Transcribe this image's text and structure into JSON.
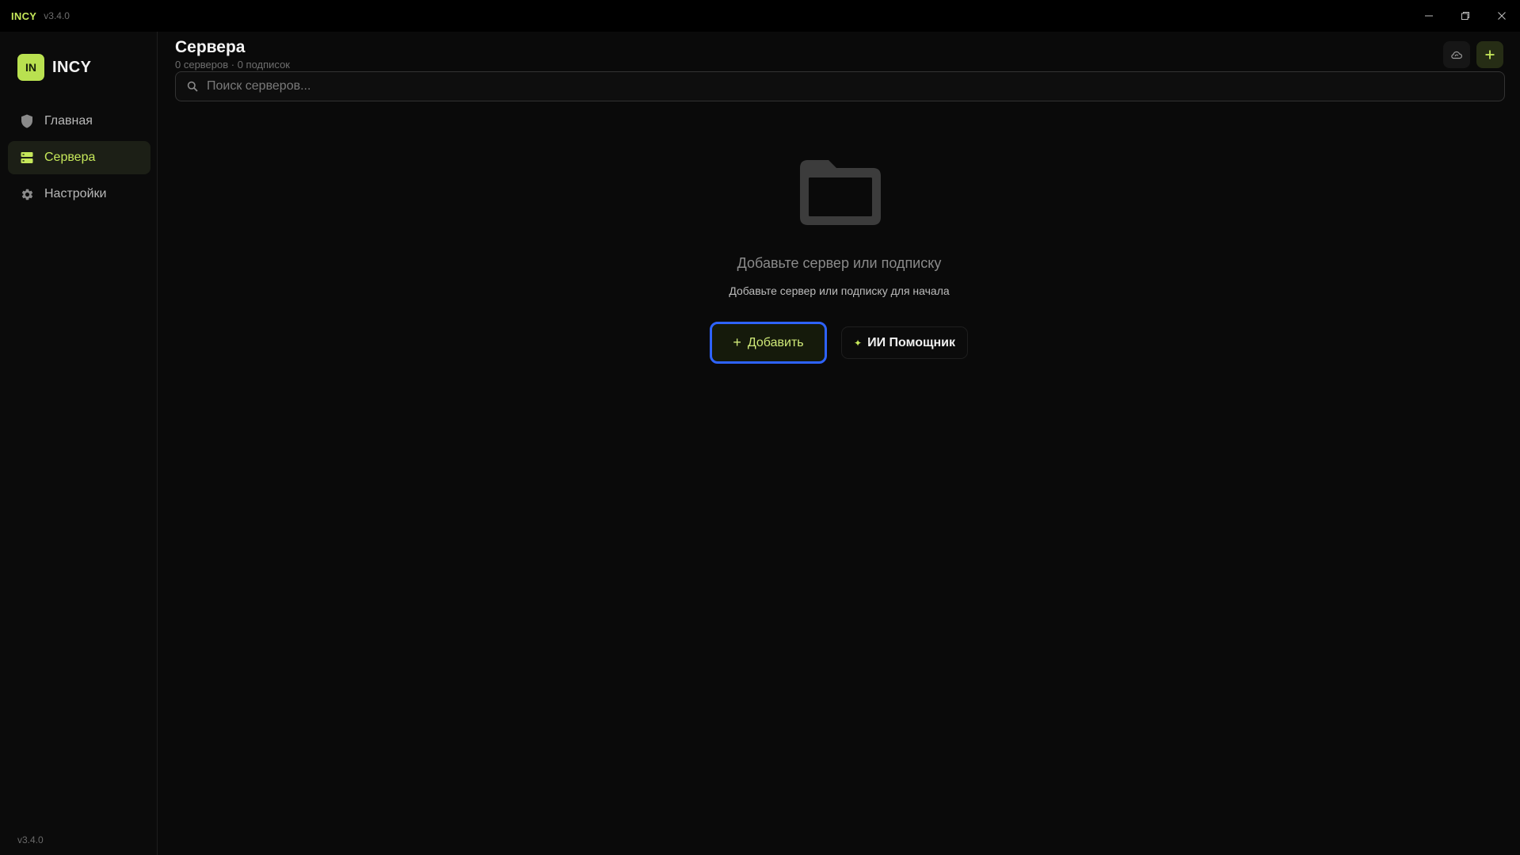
{
  "titlebar": {
    "app_name": "INCY",
    "version": "v3.4.0"
  },
  "sidebar": {
    "logo_text": "IN",
    "brand": "INCY",
    "items": [
      {
        "label": "Главная",
        "icon": "shield-icon",
        "active": false
      },
      {
        "label": "Сервера",
        "icon": "server-icon",
        "active": true
      },
      {
        "label": "Настройки",
        "icon": "gear-icon",
        "active": false
      }
    ],
    "version": "v3.4.0"
  },
  "main": {
    "title": "Сервера",
    "subtitle": "0 серверов · 0 подписок",
    "search_placeholder": "Поиск серверов..."
  },
  "empty_state": {
    "icon": "folder-icon",
    "title": "Добавьте сервер или подписку",
    "subtitle": "Добавьте сервер или подписку для начала",
    "add_button": "Добавить",
    "ai_button": "ИИ Помощник"
  },
  "colors": {
    "accent": "#c6e85a",
    "focus_ring": "#2e63ff",
    "background": "#0a0a0a"
  }
}
